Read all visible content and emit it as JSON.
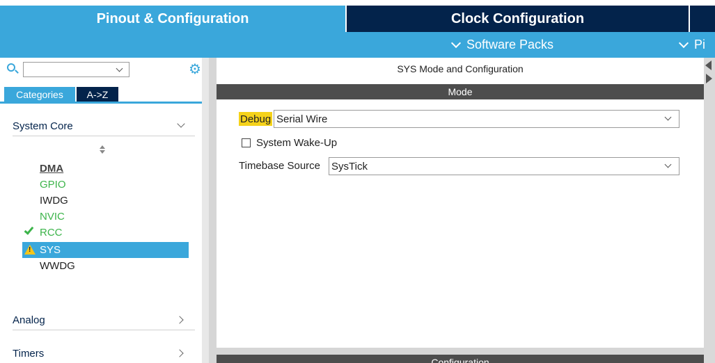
{
  "tabs": {
    "pinout": "Pinout & Configuration",
    "clock": "Clock Configuration"
  },
  "subbar": {
    "software_packs": "Software Packs",
    "pinout": "Pi"
  },
  "left": {
    "search_value": "",
    "category_tab": "Categories",
    "az_tab": "A->Z",
    "groups": {
      "system_core": "System Core",
      "analog": "Analog",
      "timers": "Timers"
    },
    "peripherals": [
      {
        "label": "DMA",
        "style": "bold"
      },
      {
        "label": "GPIO",
        "style": "green"
      },
      {
        "label": "IWDG",
        "style": "normal"
      },
      {
        "label": "NVIC",
        "style": "green"
      },
      {
        "label": "RCC",
        "style": "green-check"
      },
      {
        "label": "SYS",
        "style": "selected-warning"
      },
      {
        "label": "WWDG",
        "style": "normal"
      }
    ]
  },
  "right": {
    "title": "SYS Mode and Configuration",
    "mode_header": "Mode",
    "config_header": "Configuration",
    "debug_label": "Debug",
    "debug_value": "Serial Wire",
    "wakeup_label": "System Wake-Up",
    "wakeup_checked": false,
    "timebase_label": "Timebase Source",
    "timebase_value": "SysTick"
  },
  "colors": {
    "accent": "#3aa7db",
    "dark": "#03234b",
    "highlight": "#f5d21a",
    "ok": "#3cb44a",
    "warning": "#f5c518"
  }
}
